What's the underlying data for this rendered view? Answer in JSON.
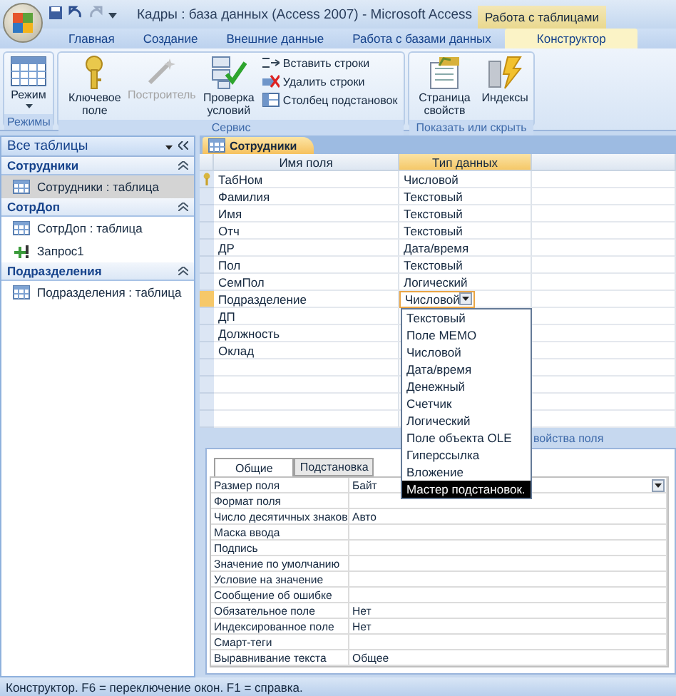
{
  "window": {
    "title": "Кадры : база данных (Access 2007) - Microsoft Access",
    "context_tab": "Работа с таблицами"
  },
  "ribbon_tabs": [
    {
      "label": "Главная",
      "selected": false
    },
    {
      "label": "Создание",
      "selected": false
    },
    {
      "label": "Внешние данные",
      "selected": false
    },
    {
      "label": "Работа с базами данных",
      "selected": false
    },
    {
      "label": "Конструктор",
      "selected": true
    }
  ],
  "ribbon_groups": [
    {
      "label": "Режимы",
      "buttons": [
        {
          "kind": "large",
          "label": "Режим",
          "caret": true,
          "disabled": false
        }
      ]
    },
    {
      "label": "Сервис",
      "buttons": [
        {
          "kind": "large",
          "label": "Ключевое поле",
          "caret": false,
          "disabled": false
        },
        {
          "kind": "large",
          "label": "Построитель",
          "caret": false,
          "disabled": true
        },
        {
          "kind": "large",
          "label": "Проверка условий",
          "caret": false,
          "disabled": false
        },
        {
          "kind": "small",
          "label": "Вставить строки",
          "disabled": false
        },
        {
          "kind": "small",
          "label": "Удалить строки",
          "disabled": false
        },
        {
          "kind": "small",
          "label": "Столбец  подстановок",
          "disabled": false
        }
      ]
    },
    {
      "label": "Показать или скрыть",
      "buttons": [
        {
          "kind": "large",
          "label": "Страница свойств",
          "caret": false,
          "disabled": false
        },
        {
          "kind": "large",
          "label": "Индексы",
          "caret": false,
          "disabled": false
        }
      ]
    }
  ],
  "nav_pane": {
    "title": "Все таблицы",
    "groups": [
      {
        "label": "Сотрудники",
        "expanded": true,
        "items": [
          {
            "kind": "table",
            "label": "Сотрудники : таблица",
            "selected": true
          }
        ]
      },
      {
        "label": "СотрДоп",
        "expanded": true,
        "items": [
          {
            "kind": "table",
            "label": "СотрДоп : таблица",
            "selected": false
          },
          {
            "kind": "query",
            "label": "Запрос1",
            "selected": false
          }
        ]
      },
      {
        "label": "Подразделения",
        "expanded": true,
        "items": [
          {
            "kind": "table",
            "label": "Подразделения : таблица",
            "selected": false
          }
        ]
      }
    ]
  },
  "document_tab": "Сотрудники",
  "field_grid": {
    "columns": [
      "Имя поля",
      "Тип данных"
    ],
    "rows": [
      {
        "name": "ТабНом",
        "type": "Числовой",
        "primary_key": true,
        "selected": false
      },
      {
        "name": "Фамилия",
        "type": "Текстовый",
        "primary_key": false,
        "selected": false
      },
      {
        "name": "Имя",
        "type": "Текстовый",
        "primary_key": false,
        "selected": false
      },
      {
        "name": "Отч",
        "type": "Текстовый",
        "primary_key": false,
        "selected": false
      },
      {
        "name": "ДР",
        "type": "Дата/время",
        "primary_key": false,
        "selected": false
      },
      {
        "name": "Пол",
        "type": "Текстовый",
        "primary_key": false,
        "selected": false
      },
      {
        "name": "СемПол",
        "type": "Логический",
        "primary_key": false,
        "selected": false
      },
      {
        "name": "Подразделение",
        "type": "Числовой",
        "primary_key": false,
        "selected": true,
        "dropdown": [
          {
            "label": "Текстовый",
            "selected": false
          },
          {
            "label": "Поле МЕМО",
            "selected": false
          },
          {
            "label": "Числовой",
            "selected": false
          },
          {
            "label": "Дата/время",
            "selected": false
          },
          {
            "label": "Денежный",
            "selected": false
          },
          {
            "label": "Счетчик",
            "selected": false
          },
          {
            "label": "Логический",
            "selected": false
          },
          {
            "label": "Поле объекта OLE",
            "selected": false
          },
          {
            "label": "Гиперссылка",
            "selected": false
          },
          {
            "label": "Вложение",
            "selected": false
          },
          {
            "label": "Мастер подстановок.",
            "selected": true
          }
        ]
      },
      {
        "name": "ДП",
        "primary_key": false,
        "selected": false
      },
      {
        "name": "Должность",
        "primary_key": false,
        "selected": false
      },
      {
        "name": "Оклад",
        "primary_key": false,
        "selected": false
      }
    ]
  },
  "properties_label": "войства поля",
  "property_tabs": [
    {
      "label": "Общие",
      "selected": true
    },
    {
      "label": "Подстановка",
      "selected": false
    }
  ],
  "properties": [
    {
      "label": "Размер поля",
      "value": "Байт",
      "dropdown": true
    },
    {
      "label": "Формат поля",
      "dropdown": false
    },
    {
      "label": "Число десятичных знаков",
      "value": "Авто",
      "dropdown": false
    },
    {
      "label": "Маска ввода",
      "dropdown": false
    },
    {
      "label": "Подпись",
      "dropdown": false
    },
    {
      "label": "Значение по умолчанию",
      "dropdown": false
    },
    {
      "label": "Условие на значение",
      "dropdown": false
    },
    {
      "label": "Сообщение об ошибке",
      "dropdown": false
    },
    {
      "label": "Обязательное поле",
      "value": "Нет",
      "dropdown": false
    },
    {
      "label": "Индексированное поле",
      "value": "Нет",
      "dropdown": false
    },
    {
      "label": "Смарт-теги",
      "dropdown": false
    },
    {
      "label": "Выравнивание текста",
      "value": "Общее",
      "dropdown": false
    }
  ],
  "status_bar": "Конструктор.  F6 = переключение окон.  F1 = справка."
}
